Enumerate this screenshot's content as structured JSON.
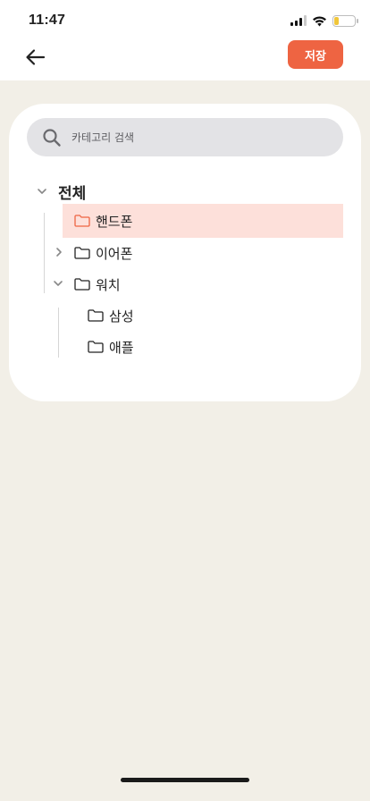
{
  "status_bar": {
    "time": "11:47"
  },
  "header": {
    "save_label": "저장"
  },
  "search": {
    "placeholder": "카테고리 검색"
  },
  "tree": {
    "root_label": "전체",
    "items": [
      {
        "label": "핸드폰",
        "selected": true
      },
      {
        "label": "이어폰",
        "expanded": false
      },
      {
        "label": "워치",
        "expanded": true,
        "children": [
          {
            "label": "삼성"
          },
          {
            "label": "애플"
          }
        ]
      }
    ]
  },
  "colors": {
    "accent": "#ee6442",
    "selected_bg": "#fde0da",
    "background": "#f2efe7",
    "search_bg": "#e3e3e6"
  },
  "icons": [
    "back-arrow-icon",
    "search-icon",
    "chevron-down-icon",
    "chevron-right-icon",
    "folder-icon"
  ]
}
